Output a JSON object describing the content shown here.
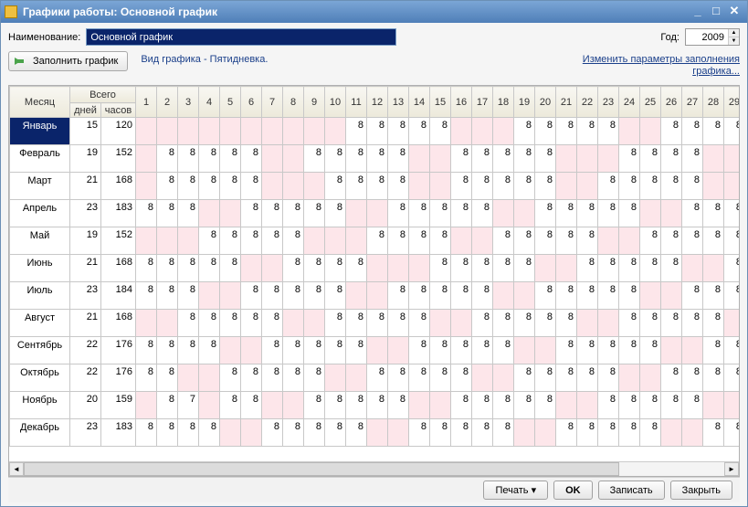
{
  "window": {
    "title": "Графики работы: Основной график"
  },
  "header": {
    "name_label": "Наименование:",
    "name_value": "Основной график",
    "year_label": "Год:",
    "year_value": "2009"
  },
  "toolbar": {
    "fill_label": "Заполнить график",
    "schedule_type": "Вид графика - Пятидневка.",
    "change_link_1": "Изменить параметры заполнения",
    "change_link_2": "графика..."
  },
  "table": {
    "headers": {
      "month": "Месяц",
      "total": "Всего",
      "days": "дней",
      "hours": "часов"
    },
    "day_numbers": [
      1,
      2,
      3,
      4,
      5,
      6,
      7,
      8,
      9,
      10,
      11,
      12,
      13,
      14,
      15,
      16,
      17,
      18,
      19,
      20,
      21,
      22,
      23,
      24,
      25,
      26,
      27,
      28,
      29
    ],
    "rows": [
      {
        "month": "Январь",
        "days": 15,
        "hours": 120,
        "cells": [
          "",
          "",
          "",
          "",
          "",
          "",
          "",
          "",
          "",
          "",
          "8",
          "8",
          "8",
          "8",
          "8",
          "",
          "",
          "",
          "8",
          "8",
          "8",
          "8",
          "8",
          "",
          "",
          "8",
          "8",
          "8",
          "8"
        ]
      },
      {
        "month": "Февраль",
        "days": 19,
        "hours": 152,
        "cells": [
          "",
          "8",
          "8",
          "8",
          "8",
          "8",
          "",
          "",
          "8",
          "8",
          "8",
          "8",
          "8",
          "",
          "",
          "8",
          "8",
          "8",
          "8",
          "8",
          "",
          "",
          "",
          "8",
          "8",
          "8",
          "8",
          "",
          ""
        ]
      },
      {
        "month": "Март",
        "days": 21,
        "hours": 168,
        "cells": [
          "",
          "8",
          "8",
          "8",
          "8",
          "8",
          "",
          "",
          "",
          "8",
          "8",
          "8",
          "8",
          "",
          "",
          "8",
          "8",
          "8",
          "8",
          "8",
          "",
          "",
          "8",
          "8",
          "8",
          "8",
          "8",
          "",
          ""
        ]
      },
      {
        "month": "Апрель",
        "days": 23,
        "hours": 183,
        "cells": [
          "8",
          "8",
          "8",
          "",
          "",
          "8",
          "8",
          "8",
          "8",
          "8",
          "",
          "",
          "8",
          "8",
          "8",
          "8",
          "8",
          "",
          "",
          "8",
          "8",
          "8",
          "8",
          "8",
          "",
          "",
          "8",
          "8",
          "8"
        ]
      },
      {
        "month": "Май",
        "days": 19,
        "hours": 152,
        "cells": [
          "",
          "",
          "",
          "8",
          "8",
          "8",
          "8",
          "8",
          "",
          "",
          "",
          "8",
          "8",
          "8",
          "8",
          "",
          "",
          "8",
          "8",
          "8",
          "8",
          "8",
          "",
          "",
          "8",
          "8",
          "8",
          "8",
          "8"
        ]
      },
      {
        "month": "Июнь",
        "days": 21,
        "hours": 168,
        "cells": [
          "8",
          "8",
          "8",
          "8",
          "8",
          "",
          "",
          "8",
          "8",
          "8",
          "8",
          "",
          "",
          "",
          "8",
          "8",
          "8",
          "8",
          "8",
          "",
          "",
          "8",
          "8",
          "8",
          "8",
          "8",
          "",
          "",
          "8"
        ]
      },
      {
        "month": "Июль",
        "days": 23,
        "hours": 184,
        "cells": [
          "8",
          "8",
          "8",
          "",
          "",
          "8",
          "8",
          "8",
          "8",
          "8",
          "",
          "",
          "8",
          "8",
          "8",
          "8",
          "8",
          "",
          "",
          "8",
          "8",
          "8",
          "8",
          "8",
          "",
          "",
          "8",
          "8",
          "8"
        ]
      },
      {
        "month": "Август",
        "days": 21,
        "hours": 168,
        "cells": [
          "",
          "",
          "8",
          "8",
          "8",
          "8",
          "8",
          "",
          "",
          "8",
          "8",
          "8",
          "8",
          "8",
          "",
          "",
          "8",
          "8",
          "8",
          "8",
          "8",
          "",
          "",
          "8",
          "8",
          "8",
          "8",
          "8",
          ""
        ]
      },
      {
        "month": "Сентябрь",
        "days": 22,
        "hours": 176,
        "cells": [
          "8",
          "8",
          "8",
          "8",
          "",
          "",
          "8",
          "8",
          "8",
          "8",
          "8",
          "",
          "",
          "8",
          "8",
          "8",
          "8",
          "8",
          "",
          "",
          "8",
          "8",
          "8",
          "8",
          "8",
          "",
          "",
          "8",
          "8"
        ]
      },
      {
        "month": "Октябрь",
        "days": 22,
        "hours": 176,
        "cells": [
          "8",
          "8",
          "",
          "",
          "8",
          "8",
          "8",
          "8",
          "8",
          "",
          "",
          "8",
          "8",
          "8",
          "8",
          "8",
          "",
          "",
          "8",
          "8",
          "8",
          "8",
          "8",
          "",
          "",
          "8",
          "8",
          "8",
          "8"
        ]
      },
      {
        "month": "Ноябрь",
        "days": 20,
        "hours": 159,
        "cells": [
          "",
          "8",
          "7",
          "",
          "8",
          "8",
          "",
          "",
          "8",
          "8",
          "8",
          "8",
          "8",
          "",
          "",
          "8",
          "8",
          "8",
          "8",
          "8",
          "",
          "",
          "8",
          "8",
          "8",
          "8",
          "8",
          "",
          ""
        ]
      },
      {
        "month": "Декабрь",
        "days": 23,
        "hours": 183,
        "cells": [
          "8",
          "8",
          "8",
          "8",
          "",
          "",
          "8",
          "8",
          "8",
          "8",
          "8",
          "",
          "",
          "8",
          "8",
          "8",
          "8",
          "8",
          "",
          "",
          "8",
          "8",
          "8",
          "8",
          "8",
          "",
          "",
          "8",
          "8"
        ]
      }
    ]
  },
  "footer": {
    "print": "Печать",
    "ok": "OK",
    "save": "Записать",
    "close": "Закрыть"
  }
}
